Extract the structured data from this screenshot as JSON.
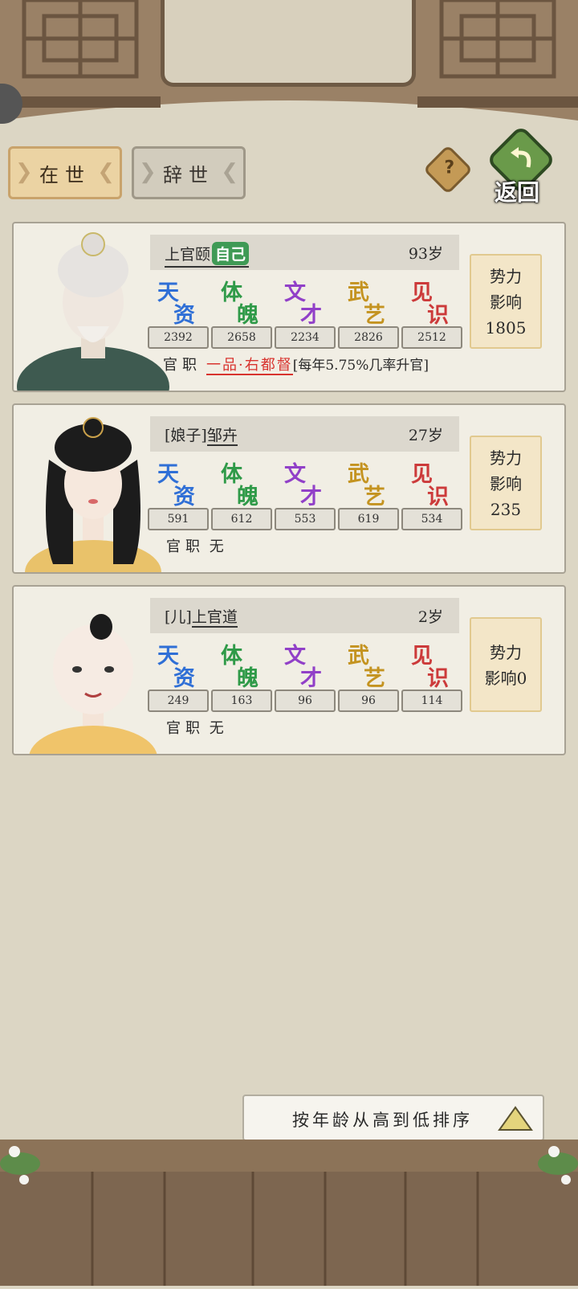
{
  "tabs": {
    "alive": "在世",
    "deceased": "辞世"
  },
  "help_icon": "?",
  "back_label": "返回",
  "colors": {
    "tian": "#2f6fd6",
    "ti": "#2f9a48",
    "wen": "#9140c8",
    "wu": "#c49320",
    "jian": "#cc3a3a",
    "office_title": "#d8332e"
  },
  "stat_labels": [
    {
      "c1": "天",
      "c2": "资"
    },
    {
      "c1": "体",
      "c2": "魄"
    },
    {
      "c1": "文",
      "c2": "才"
    },
    {
      "c1": "武",
      "c2": "艺"
    },
    {
      "c1": "见",
      "c2": "识"
    }
  ],
  "members": [
    {
      "name": "上官颐",
      "self_tag": "自己",
      "age": "93岁",
      "stats": [
        "2392",
        "2658",
        "2234",
        "2826",
        "2512"
      ],
      "office_label": "官职",
      "office_title": "一品·右都督",
      "office_note": "[每年5.75%几率升官]",
      "influence": [
        "势力",
        "影响",
        "1805"
      ]
    },
    {
      "prefix": "[娘子]",
      "name": "邹卉",
      "age": "27岁",
      "stats": [
        "591",
        "612",
        "553",
        "619",
        "534"
      ],
      "office_label": "官职",
      "office_value": "无",
      "influence": [
        "势力",
        "影响",
        "235"
      ]
    },
    {
      "prefix": "[儿]",
      "name": "上官道",
      "age": "2岁",
      "stats": [
        "249",
        "163",
        "96",
        "96",
        "114"
      ],
      "office_label": "官职",
      "office_value": "无",
      "influence": [
        "势力",
        "影响0"
      ]
    }
  ],
  "sort_label": "按年龄从高到低排序"
}
